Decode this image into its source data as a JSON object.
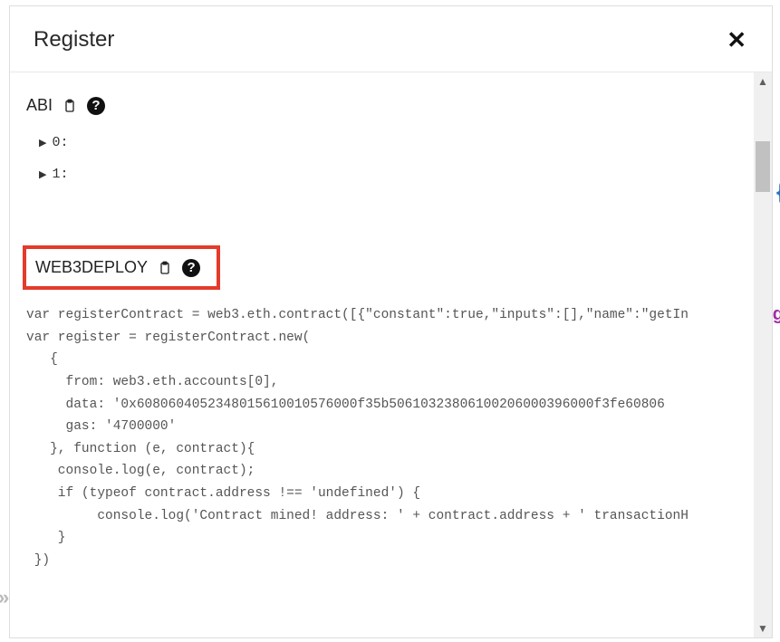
{
  "modal": {
    "title": "Register",
    "close_glyph": "✕"
  },
  "abi": {
    "label": "ABI",
    "items": [
      {
        "label": "0:"
      },
      {
        "label": "1:"
      }
    ]
  },
  "web3": {
    "label": "WEB3DEPLOY",
    "code": "var registerContract = web3.eth.contract([{\"constant\":true,\"inputs\":[],\"name\":\"getIn\nvar register = registerContract.new(\n   {\n     from: web3.eth.accounts[0],\n     data: '0x6080604052348015610010576000f35b50610323806100206000396000f3fe60806\n     gas: '4700000'\n   }, function (e, contract){\n    console.log(e, contract);\n    if (typeof contract.address !== 'undefined') {\n         console.log('Contract mined! address: ' + contract.address + ' transactionH\n    }\n })"
  },
  "scrollbar": {
    "up_glyph": "▲",
    "down_glyph": "▼"
  },
  "behind": {
    "char1": "{",
    "char2": "g",
    "chev": "»\n»"
  }
}
